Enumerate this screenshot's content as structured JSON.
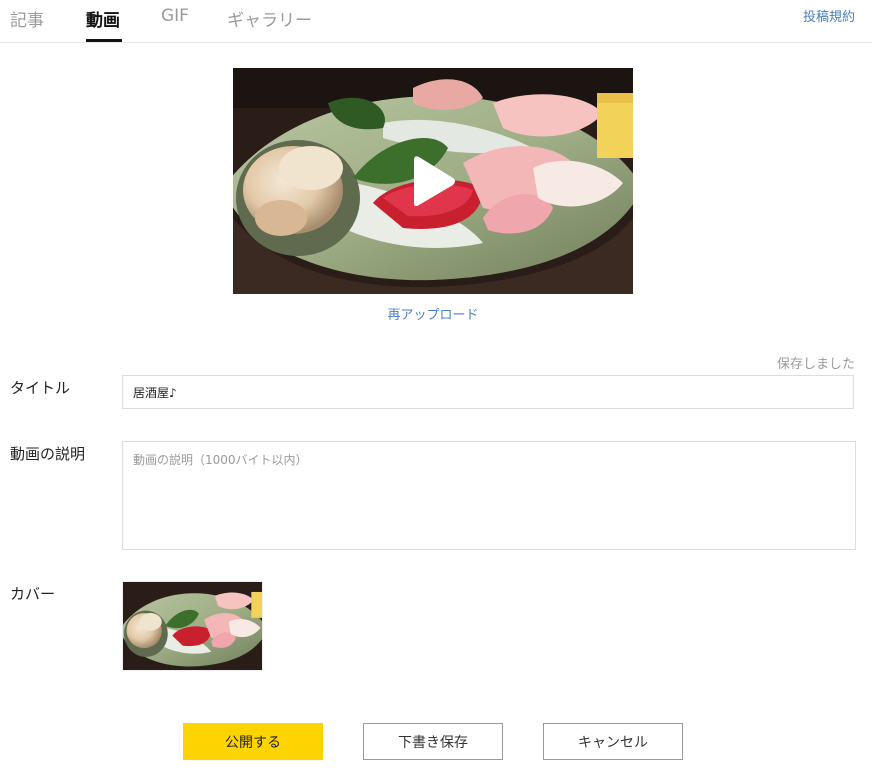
{
  "tabs": [
    {
      "label": "記事",
      "active": false
    },
    {
      "label": "動画",
      "active": true
    },
    {
      "label": "GIF",
      "active": false
    },
    {
      "label": "ギャラリー",
      "active": false
    }
  ],
  "header": {
    "terms_link": "投稿規約"
  },
  "video": {
    "reupload_label": "再アップロード",
    "play_icon": "play-icon"
  },
  "form": {
    "saved_status": "保存しました",
    "title_label": "タイトル",
    "title_value": "居酒屋♪",
    "description_label": "動画の説明",
    "description_placeholder": "動画の説明（1000バイト以内）",
    "cover_label": "カバー"
  },
  "actions": {
    "publish_label": "公開する",
    "draft_label": "下書き保存",
    "cancel_label": "キャンセル"
  },
  "colors": {
    "accent_yellow": "#fdd300",
    "link_blue": "#4a7fc1",
    "active_tab": "#111111",
    "inactive_tab": "#9a9a9a"
  }
}
